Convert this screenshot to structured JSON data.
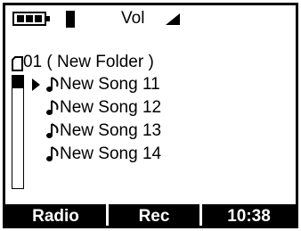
{
  "status": {
    "battery_icon": "battery-icon",
    "signal_icon": "signal-bar-icon",
    "volume_label": "Vol"
  },
  "folder": {
    "icon": "folder-icon",
    "label": "01  ( New Folder )"
  },
  "songs": [
    {
      "title": "New Song 11",
      "selected": true
    },
    {
      "title": "New Song 12",
      "selected": false
    },
    {
      "title": "New Song 13",
      "selected": false
    },
    {
      "title": "New Song 14",
      "selected": false
    }
  ],
  "softkeys": {
    "left": "Radio",
    "middle": "Rec",
    "right": "10:38"
  },
  "colors": {
    "foreground": "#000000",
    "background": "#ffffff"
  }
}
